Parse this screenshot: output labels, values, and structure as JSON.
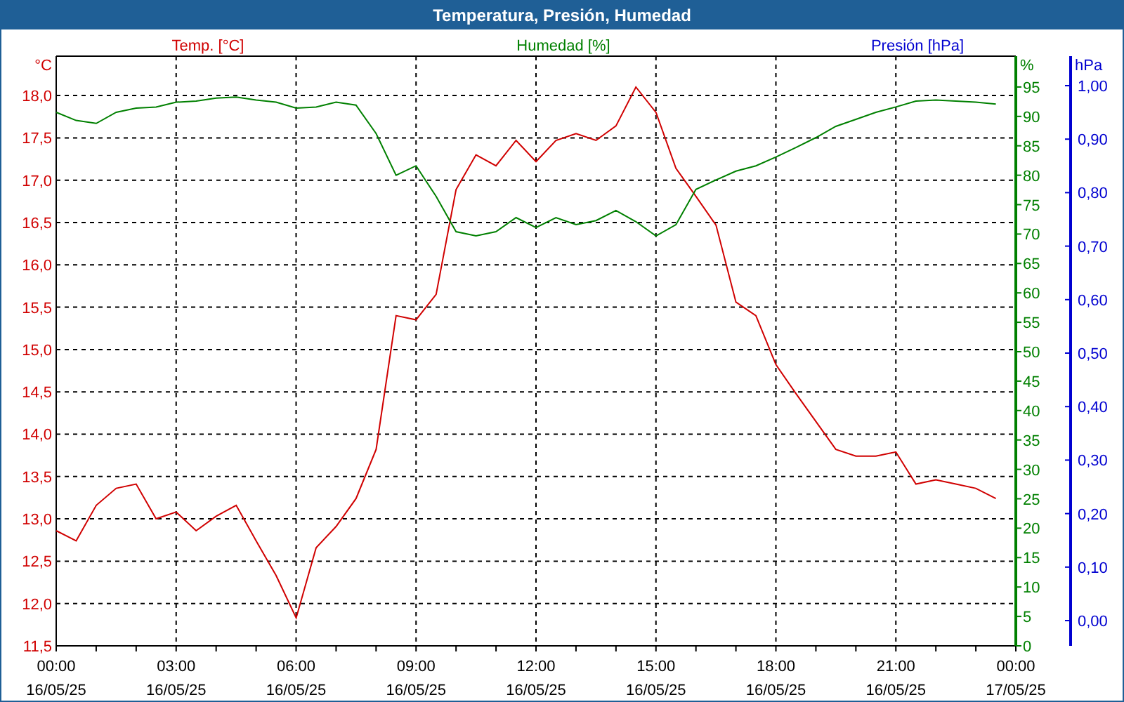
{
  "window": {
    "title": "Temperatura, Presión, Humedad"
  },
  "chart": {
    "pressure_axis": {
      "title": "Presión [hPa]",
      "color": "#0000d0"
    },
    "chart_data": {
      "type": "line",
      "grid": true,
      "ylabel": "°C",
      "ylim": [
        11.5,
        18.465
      ],
      "yticks": [
        {
          "value": 18,
          "label": "18,0"
        },
        {
          "value": 17.5,
          "label": "17,5"
        },
        {
          "value": 17,
          "label": "17,0"
        },
        {
          "value": 16.5,
          "label": "16,5"
        },
        {
          "value": 16,
          "label": "16,0"
        },
        {
          "value": 15.5,
          "label": "15,5"
        },
        {
          "value": 15,
          "label": "15,0"
        },
        {
          "value": 14.5,
          "label": "14,5"
        },
        {
          "value": 14,
          "label": "14,0"
        },
        {
          "value": 13.5,
          "label": "13,5"
        },
        {
          "value": 13,
          "label": "13,0"
        },
        {
          "value": 12.5,
          "label": "12,5"
        },
        {
          "value": 12,
          "label": "12,0"
        },
        {
          "value": 11.5,
          "label": "11,5"
        }
      ],
      "y2label": "%",
      "y2lim": [
        0,
        100.24
      ],
      "y2ticks": [
        95,
        90,
        85,
        80,
        75,
        70,
        65,
        60,
        55,
        50,
        45,
        40,
        35,
        30,
        25,
        20,
        15,
        10,
        5,
        0
      ],
      "y3label": "hPa",
      "y3lim": [
        -0.0472,
        1.0551
      ],
      "y3ticks": [
        {
          "value": 1.0,
          "label": "1,00"
        },
        {
          "value": 0.9,
          "label": "0,90"
        },
        {
          "value": 0.8,
          "label": "0,80"
        },
        {
          "value": 0.7,
          "label": "0,70"
        },
        {
          "value": 0.6,
          "label": "0,60"
        },
        {
          "value": 0.5,
          "label": "0,50"
        },
        {
          "value": 0.4,
          "label": "0,40"
        },
        {
          "value": 0.3,
          "label": "0,30"
        },
        {
          "value": 0.2,
          "label": "0,20"
        },
        {
          "value": 0.1,
          "label": "0,10"
        },
        {
          "value": 0,
          "label": "0,00"
        }
      ],
      "categories": [
        "00:00 16/05/25",
        null,
        null,
        null,
        null,
        null,
        "03:00 16/05/25",
        null,
        null,
        null,
        null,
        null,
        "06:00 16/05/25",
        null,
        null,
        null,
        null,
        null,
        "09:00 16/05/25",
        null,
        null,
        null,
        null,
        null,
        "12:00 16/05/25",
        null,
        null,
        null,
        null,
        null,
        "15:00 16/05/25",
        null,
        null,
        null,
        null,
        null,
        "18:00 16/05/25",
        null,
        null,
        null,
        null,
        null,
        "21:00 16/05/25",
        null,
        null,
        null,
        null,
        null,
        "00:00 17/05/25"
      ],
      "series": [
        {
          "name": "Temp. [°C]",
          "color": "#d00000",
          "values": [
            12.86,
            12.74,
            13.16,
            13.36,
            13.41,
            13.0,
            13.08,
            12.86,
            13.03,
            13.16,
            12.74,
            12.33,
            11.83,
            12.66,
            12.91,
            13.24,
            13.82,
            15.4,
            15.35,
            15.65,
            16.89,
            17.3,
            17.17,
            17.47,
            17.22,
            17.47,
            17.55,
            17.47,
            17.64,
            18.1,
            17.8,
            17.14,
            16.81,
            16.47,
            15.56,
            15.4,
            14.82,
            14.48,
            14.15,
            13.82,
            13.74,
            13.74,
            13.79,
            13.41,
            13.46,
            13.41,
            13.36,
            13.24,
            null
          ]
        },
        {
          "name": "Humedad [%]",
          "color": "#008000",
          "axis": "y2",
          "values": [
            90.7,
            89.3,
            88.8,
            90.7,
            91.4,
            91.6,
            92.4,
            92.6,
            93.1,
            93.3,
            92.8,
            92.4,
            91.4,
            91.6,
            92.4,
            91.9,
            87.1,
            80,
            81.6,
            76.4,
            70.4,
            69.7,
            70.4,
            72.8,
            71.1,
            72.8,
            71.6,
            72.3,
            74,
            72.1,
            69.7,
            71.6,
            77.6,
            79.2,
            80.7,
            81.6,
            83.1,
            84.7,
            86.4,
            88.3,
            89.5,
            90.7,
            91.6,
            92.6,
            92.8,
            92.6,
            92.4,
            92.1,
            null
          ]
        }
      ]
    }
  }
}
